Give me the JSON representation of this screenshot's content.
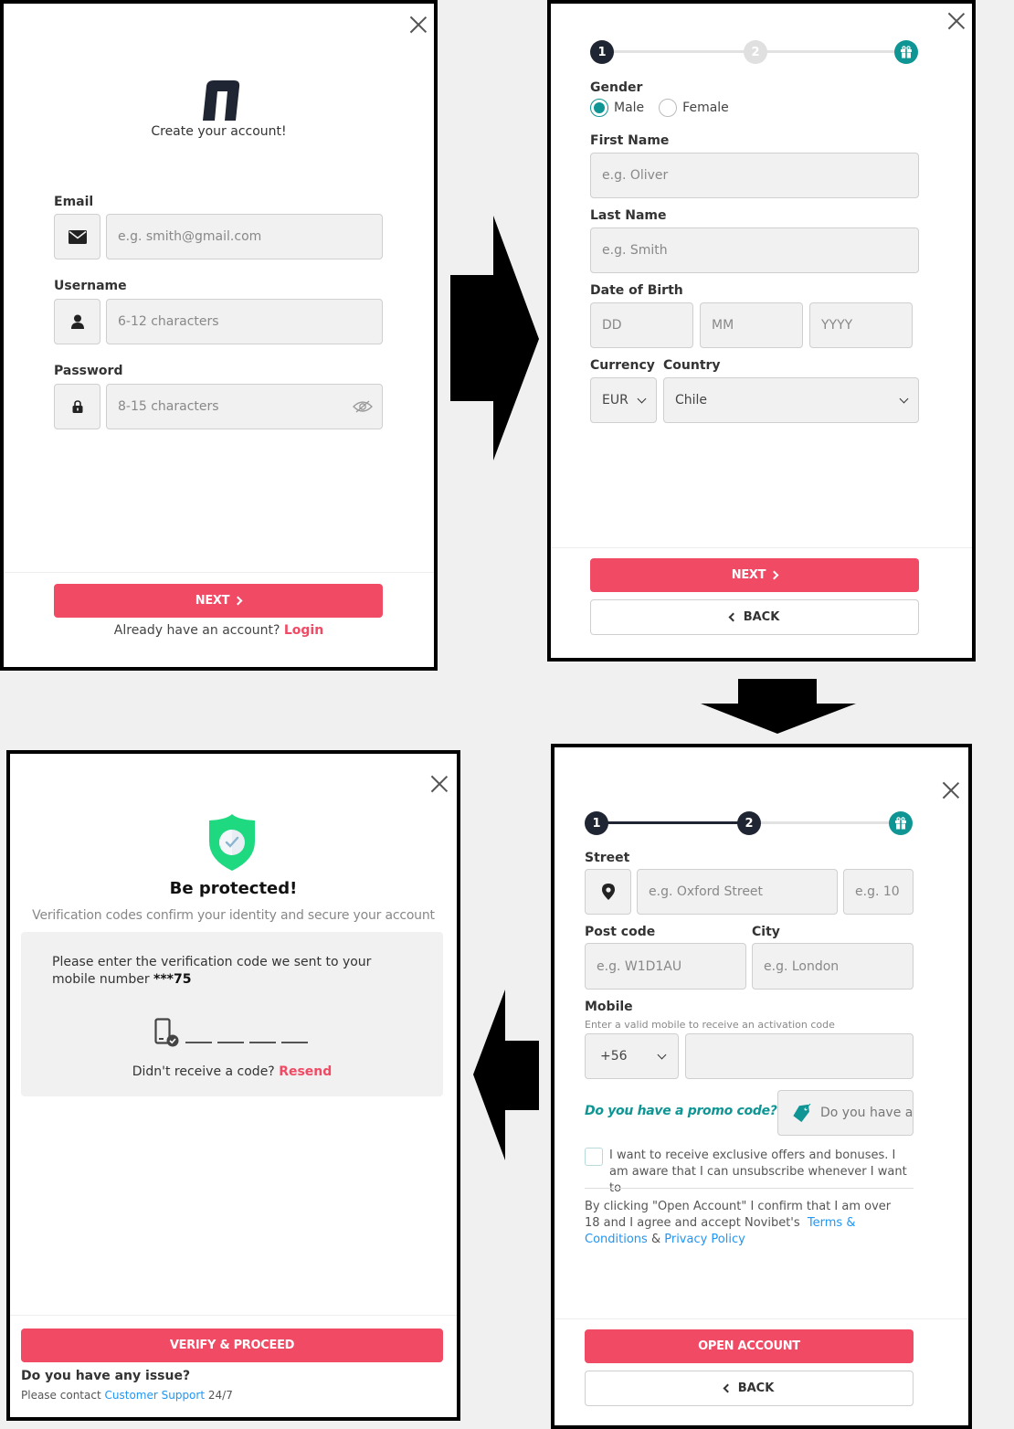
{
  "colors": {
    "accent": "#f14a64",
    "teal": "#0e9594",
    "navy": "#1f2533",
    "link": "#2196f3"
  },
  "step1": {
    "logo": "n",
    "subtitle": "Create your account!",
    "email": {
      "label": "Email",
      "placeholder": "e.g. smith@gmail.com",
      "icon": "envelope-icon"
    },
    "username": {
      "label": "Username",
      "placeholder": "6-12 characters",
      "icon": "user-icon"
    },
    "password": {
      "label": "Password",
      "placeholder": "8-15 characters",
      "icon": "lock-icon",
      "toggle_icon": "eye-slash-icon"
    },
    "next_label": "NEXT",
    "login_prompt": "Already have an account?",
    "login_link": "Login"
  },
  "step2": {
    "stepper": {
      "steps": [
        "1",
        "2"
      ],
      "current": 1
    },
    "gender": {
      "label": "Gender",
      "options": [
        "Male",
        "Female"
      ],
      "selected": "Male"
    },
    "first_name": {
      "label": "First Name",
      "placeholder": "e.g. Oliver"
    },
    "last_name": {
      "label": "Last Name",
      "placeholder": "e.g. Smith"
    },
    "dob": {
      "label": "Date of Birth",
      "day": "DD",
      "month": "MM",
      "year": "YYYY"
    },
    "currency": {
      "label": "Currency",
      "value": "EUR"
    },
    "country": {
      "label": "Country",
      "value": "Chile"
    },
    "next_label": "NEXT",
    "back_label": "BACK"
  },
  "step3": {
    "stepper": {
      "steps": [
        "1",
        "2"
      ],
      "current": 2
    },
    "street": {
      "label": "Street",
      "placeholder": "e.g. Oxford Street",
      "number_placeholder": "e.g. 10"
    },
    "post_code": {
      "label": "Post code",
      "placeholder": "e.g. W1D1AU"
    },
    "city": {
      "label": "City",
      "placeholder": "e.g. London"
    },
    "mobile": {
      "label": "Mobile",
      "hint": "Enter a valid mobile to receive an activation code",
      "prefix": "+56",
      "value": ""
    },
    "promo": {
      "label": "Do you have a promo code?",
      "placeholder": "Do you have a promo code?"
    },
    "offers_checkbox": {
      "text": "I want to receive exclusive offers and bonuses. I am aware that I can unsubscribe whenever I want to",
      "checked": false
    },
    "terms": {
      "text": "By clicking \"Open Account\" I confirm that I am over 18 and I agree and accept Novibet's",
      "terms_link": "Terms & Conditions",
      "amp": "&",
      "privacy_link": "Privacy Policy"
    },
    "open_label": "OPEN ACCOUNT",
    "back_label": "BACK"
  },
  "step4": {
    "title": "Be protected!",
    "subtitle": "Verification codes confirm your identity and secure your account",
    "instruction": "Please enter the verification code we sent to your mobile number",
    "masked_number": "***75",
    "code_digits": [
      "",
      "",
      "",
      ""
    ],
    "resend_prompt": "Didn't receive a code?",
    "resend_link": "Resend",
    "verify_label": "VERIFY & PROCEED",
    "issue_title": "Do you have any issue?",
    "contact_prefix": "Please contact",
    "support_link": "Customer Support",
    "contact_suffix": "24/7"
  }
}
